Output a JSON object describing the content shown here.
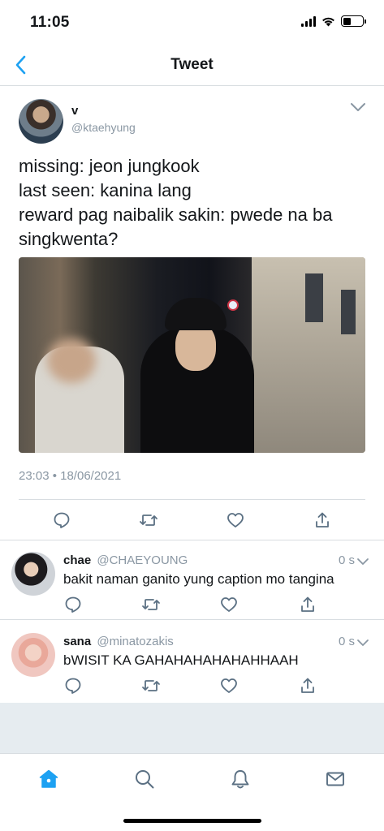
{
  "status_bar": {
    "time": "11:05"
  },
  "header": {
    "title": "Tweet"
  },
  "tweet": {
    "author_name": "v",
    "author_handle": "@ktaehyung",
    "text": "missing: jeon jungkook\nlast seen: kanina lang\nreward pag naibalik sakin: pwede na ba singkwenta?",
    "timestamp": "23:03 • 18/06/2021"
  },
  "replies": [
    {
      "name": "chae",
      "handle": "@CHAEYOUNG",
      "time": "0 s",
      "text": "bakit naman ganito yung caption mo tangina"
    },
    {
      "name": "sana",
      "handle": "@minatozakis",
      "time": "0 s",
      "text": "bWISIT KA GAHAHAHAHAHAHHAAH"
    }
  ],
  "icons": {
    "back": "chevron-left-icon",
    "menu": "chevron-down-icon",
    "reply": "comment-icon",
    "retweet": "retweet-icon",
    "like": "heart-icon",
    "share": "share-icon",
    "tabs": [
      "home-icon",
      "search-icon",
      "bell-icon",
      "mail-icon"
    ]
  },
  "colors": {
    "accent": "#1da1f2",
    "secondary_text": "#8a97a3",
    "icon": "#5b7083"
  }
}
